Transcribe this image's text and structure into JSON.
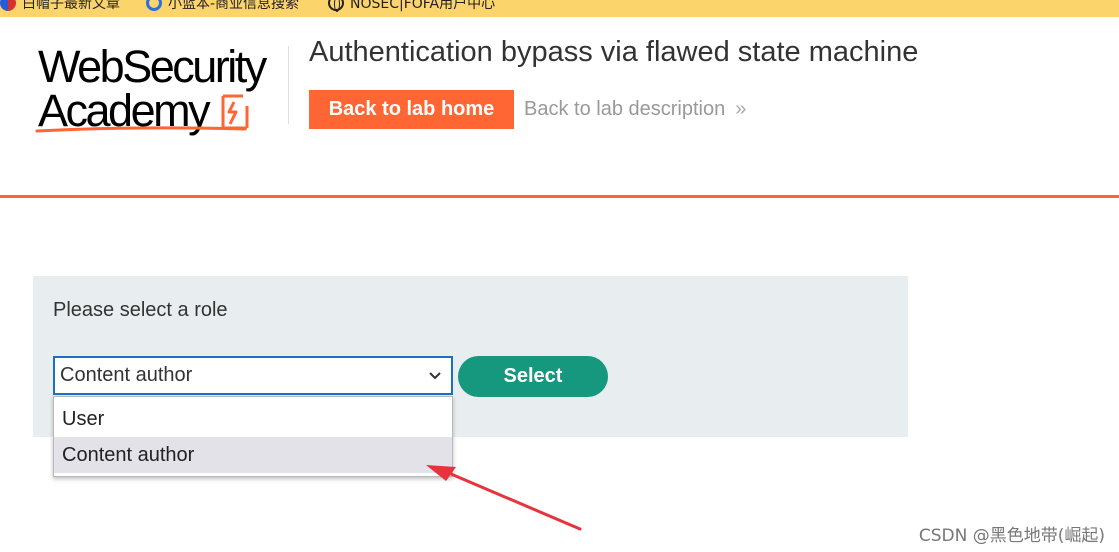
{
  "bookmarks": [
    {
      "label": "白帽子最新文章",
      "icon": "flag-icon"
    },
    {
      "label": "小蓝本-商业信息搜索",
      "icon": "g-logo-icon"
    },
    {
      "label": "NOSEC|FOFA用户中心",
      "icon": "globe-icon"
    }
  ],
  "logo": {
    "line1": "WebSecurity",
    "line2": "Academy"
  },
  "header": {
    "title": "Authentication bypass via flawed state machine",
    "back_home_label": "Back to lab home",
    "back_desc_label": "Back to lab description",
    "back_desc_chevron": "»"
  },
  "role_form": {
    "prompt": "Please select a role",
    "selected_value": "Content author",
    "options": [
      "User",
      "Content author"
    ],
    "highlighted_option": "Content author",
    "submit_label": "Select"
  },
  "watermark": "CSDN @黑色地带(崛起)",
  "colors": {
    "accent_orange": "#ff6633",
    "select_button": "#16987e",
    "panel_bg": "#e8eef0",
    "bookmarks_bg": "#fbd46c",
    "focus_border": "#1a71c4",
    "annotation_arrow": "#e8323c"
  }
}
